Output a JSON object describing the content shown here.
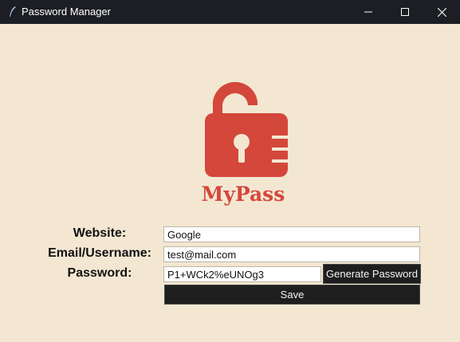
{
  "window": {
    "title": "Password Manager"
  },
  "logo": {
    "text": "MyPass",
    "color": "#d4473b"
  },
  "form": {
    "website_label": "Website:",
    "website_value": "Google",
    "email_label": "Email/Username:",
    "email_value": "test@mail.com",
    "password_label": "Password:",
    "password_value": "P1+WCk2%eUNOg3"
  },
  "buttons": {
    "generate_label": "Generate Password",
    "save_label": "Save"
  },
  "colors": {
    "background": "#f3e7d2",
    "titlebar": "#1c1e23",
    "button": "#1e1e1e",
    "accent": "#d4473b"
  }
}
